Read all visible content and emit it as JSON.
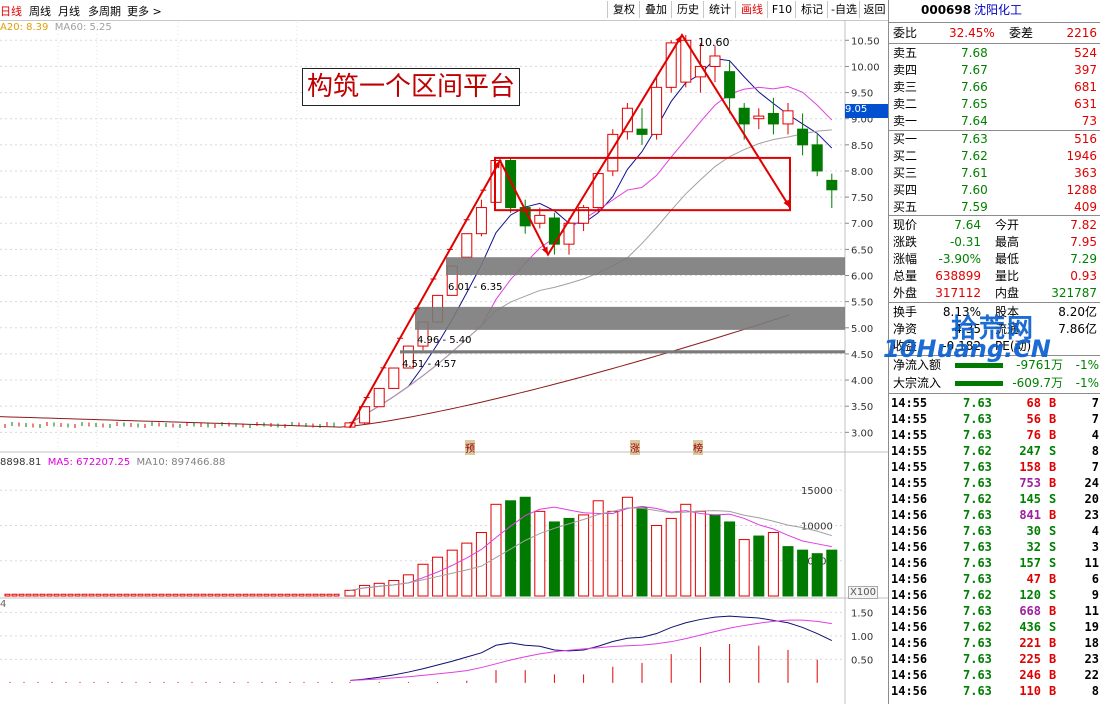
{
  "topbar": {
    "tabs": [
      "日线",
      "周线",
      "月线",
      "多周期",
      "更多 >"
    ],
    "buttons": [
      "复权",
      "叠加",
      "历史",
      "统计",
      "画线",
      "F10",
      "标记",
      "-自选",
      "返回"
    ],
    "active_button": "画线"
  },
  "indicators": {
    "ma_line": [
      "A20: 8.39",
      "MA60: 5.25"
    ],
    "vol_line": [
      "8898.81",
      "MA5: 672207.25",
      "MA10: 897466.88"
    ],
    "macd_line": "4",
    "vol_unit": "X100"
  },
  "annotations": {
    "headline": "构筑一个区间平台",
    "peak_label": "10.60",
    "gap1": "6.01 - 6.35",
    "gap2": "4.96 - 5.40",
    "gap3": "4.51 - 4.57",
    "markers": [
      "预",
      "涨",
      "榜"
    ],
    "price_tag": "9.05"
  },
  "colors": {
    "up": "#e00000",
    "down": "#007a00",
    "accent": "#e00000"
  },
  "chart_data": {
    "type": "candlestick",
    "price_axis": {
      "ticks": [
        "10.50",
        "10.00",
        "9.50",
        "9.00",
        "8.50",
        "8.00",
        "7.50",
        "7.00",
        "6.50",
        "6.00",
        "5.50",
        "5.00",
        "4.50",
        "4.00",
        "3.50",
        "3.00"
      ],
      "range": [
        2.7,
        10.85
      ]
    },
    "volume_axis": {
      "ticks": [
        "15000",
        "10000",
        "5000"
      ],
      "range": [
        0,
        19000
      ]
    },
    "macd_axis": {
      "ticks": [
        "1.50",
        "1.00",
        "0.50"
      ],
      "range": [
        -0.45,
        1.7
      ]
    },
    "candles": [
      {
        "o": 3.1,
        "h": 3.2,
        "l": 3.08,
        "c": 3.18
      },
      {
        "o": 3.18,
        "h": 3.5,
        "l": 3.15,
        "c": 3.49
      },
      {
        "o": 3.49,
        "h": 3.85,
        "l": 3.49,
        "c": 3.84
      },
      {
        "o": 3.84,
        "h": 4.24,
        "l": 3.84,
        "c": 4.23
      },
      {
        "o": 4.23,
        "h": 4.66,
        "l": 4.23,
        "c": 4.65
      },
      {
        "o": 4.65,
        "h": 5.12,
        "l": 4.57,
        "c": 5.11
      },
      {
        "o": 5.11,
        "h": 5.62,
        "l": 5.11,
        "c": 5.62
      },
      {
        "o": 5.62,
        "h": 6.18,
        "l": 5.62,
        "c": 6.18
      },
      {
        "o": 6.35,
        "h": 6.8,
        "l": 6.35,
        "c": 6.8
      },
      {
        "o": 6.8,
        "h": 7.45,
        "l": 6.75,
        "c": 7.3
      },
      {
        "o": 7.4,
        "h": 8.2,
        "l": 7.4,
        "c": 8.2
      },
      {
        "o": 8.2,
        "h": 8.25,
        "l": 7.2,
        "c": 7.3
      },
      {
        "o": 7.3,
        "h": 7.45,
        "l": 6.8,
        "c": 6.95
      },
      {
        "o": 7.0,
        "h": 7.3,
        "l": 6.9,
        "c": 7.15
      },
      {
        "o": 7.1,
        "h": 7.2,
        "l": 6.4,
        "c": 6.6
      },
      {
        "o": 6.6,
        "h": 7.1,
        "l": 6.4,
        "c": 7.0
      },
      {
        "o": 7.0,
        "h": 7.35,
        "l": 6.85,
        "c": 7.3
      },
      {
        "o": 7.3,
        "h": 8.0,
        "l": 7.2,
        "c": 7.95
      },
      {
        "o": 8.0,
        "h": 8.8,
        "l": 7.9,
        "c": 8.7
      },
      {
        "o": 8.75,
        "h": 9.3,
        "l": 8.6,
        "c": 9.2
      },
      {
        "o": 8.8,
        "h": 9.2,
        "l": 8.5,
        "c": 8.7
      },
      {
        "o": 8.7,
        "h": 9.8,
        "l": 8.6,
        "c": 9.6
      },
      {
        "o": 9.6,
        "h": 10.5,
        "l": 9.5,
        "c": 10.45
      },
      {
        "o": 9.7,
        "h": 10.6,
        "l": 9.6,
        "c": 10.5
      },
      {
        "o": 9.8,
        "h": 10.45,
        "l": 9.5,
        "c": 10.0
      },
      {
        "o": 10.0,
        "h": 10.4,
        "l": 9.7,
        "c": 10.2
      },
      {
        "o": 9.9,
        "h": 10.1,
        "l": 9.1,
        "c": 9.4
      },
      {
        "o": 9.2,
        "h": 9.3,
        "l": 8.6,
        "c": 8.9
      },
      {
        "o": 9.0,
        "h": 9.2,
        "l": 8.8,
        "c": 9.05
      },
      {
        "o": 9.1,
        "h": 9.4,
        "l": 8.7,
        "c": 8.9
      },
      {
        "o": 8.9,
        "h": 9.3,
        "l": 8.7,
        "c": 9.15
      },
      {
        "o": 8.8,
        "h": 9.1,
        "l": 8.3,
        "c": 8.5
      },
      {
        "o": 8.5,
        "h": 8.7,
        "l": 7.9,
        "c": 8.0
      },
      {
        "o": 7.82,
        "h": 7.95,
        "l": 7.29,
        "c": 7.64
      }
    ],
    "volume": [
      {
        "v": 800,
        "up": true
      },
      {
        "v": 1500,
        "up": true
      },
      {
        "v": 1800,
        "up": true
      },
      {
        "v": 2200,
        "up": true
      },
      {
        "v": 3000,
        "up": true
      },
      {
        "v": 4500,
        "up": true
      },
      {
        "v": 5500,
        "up": true
      },
      {
        "v": 6500,
        "up": true
      },
      {
        "v": 7500,
        "up": true
      },
      {
        "v": 9000,
        "up": true
      },
      {
        "v": 13000,
        "up": true
      },
      {
        "v": 13500,
        "up": false
      },
      {
        "v": 14000,
        "up": false
      },
      {
        "v": 12000,
        "up": true
      },
      {
        "v": 10500,
        "up": false
      },
      {
        "v": 11000,
        "up": false
      },
      {
        "v": 11500,
        "up": true
      },
      {
        "v": 13500,
        "up": true
      },
      {
        "v": 12000,
        "up": true
      },
      {
        "v": 14000,
        "up": true
      },
      {
        "v": 12500,
        "up": false
      },
      {
        "v": 10000,
        "up": true
      },
      {
        "v": 11000,
        "up": true
      },
      {
        "v": 13000,
        "up": true
      },
      {
        "v": 12000,
        "up": true
      },
      {
        "v": 11500,
        "up": false
      },
      {
        "v": 10500,
        "up": false
      },
      {
        "v": 8000,
        "up": true
      },
      {
        "v": 8500,
        "up": false
      },
      {
        "v": 9000,
        "up": true
      },
      {
        "v": 7000,
        "up": false
      },
      {
        "v": 6500,
        "up": false
      },
      {
        "v": 6000,
        "up": false
      },
      {
        "v": 6500,
        "up": false
      }
    ],
    "macd": [
      0.05,
      0.08,
      0.12,
      0.17,
      0.23,
      0.3,
      0.38,
      0.46,
      0.55,
      0.64,
      0.8,
      0.85,
      0.8,
      0.78,
      0.7,
      0.68,
      0.7,
      0.78,
      0.88,
      0.95,
      0.97,
      1.05,
      1.18,
      1.28,
      1.35,
      1.4,
      1.42,
      1.4,
      1.38,
      1.33,
      1.28,
      1.18,
      1.05,
      0.9
    ]
  },
  "quote": {
    "code": "000698",
    "name": "沈阳化工",
    "weibi": {
      "label": "委比",
      "value": "32.45%",
      "label2": "委差",
      "value2": "2216"
    },
    "sells": [
      {
        "label": "卖五",
        "price": "7.68",
        "vol": "524"
      },
      {
        "label": "卖四",
        "price": "7.67",
        "vol": "397"
      },
      {
        "label": "卖三",
        "price": "7.66",
        "vol": "681"
      },
      {
        "label": "卖二",
        "price": "7.65",
        "vol": "631"
      },
      {
        "label": "卖一",
        "price": "7.64",
        "vol": "73"
      }
    ],
    "buys": [
      {
        "label": "买一",
        "price": "7.63",
        "vol": "516"
      },
      {
        "label": "买二",
        "price": "7.62",
        "vol": "1946"
      },
      {
        "label": "买三",
        "price": "7.61",
        "vol": "363"
      },
      {
        "label": "买四",
        "price": "7.60",
        "vol": "1288"
      },
      {
        "label": "买五",
        "price": "7.59",
        "vol": "409"
      }
    ],
    "stats": [
      {
        "l1": "现价",
        "v1": "7.64",
        "c1": "green",
        "l2": "今开",
        "v2": "7.82",
        "c2": "red"
      },
      {
        "l1": "涨跌",
        "v1": "-0.31",
        "c1": "green",
        "l2": "最高",
        "v2": "7.95",
        "c2": "red"
      },
      {
        "l1": "涨幅",
        "v1": "-3.90%",
        "c1": "green",
        "l2": "最低",
        "v2": "7.29",
        "c2": "green"
      },
      {
        "l1": "总量",
        "v1": "638899",
        "c1": "red",
        "l2": "量比",
        "v2": "0.93",
        "c2": "red"
      },
      {
        "l1": "外盘",
        "v1": "317112",
        "c1": "red",
        "l2": "内盘",
        "v2": "321787",
        "c2": "green"
      }
    ],
    "stats2": [
      {
        "l1": "换手",
        "v1": "8.13%",
        "l2": "股本",
        "v2": "8.20亿"
      },
      {
        "l1": "净资",
        "v1": "4.35",
        "l2": "流通",
        "v2": "7.86亿"
      },
      {
        "l1": "收益",
        "v1": "-0.182",
        "l2": "PE(动)",
        "v2": ""
      }
    ],
    "flows": [
      {
        "label": "净流入额",
        "value": "-9761万",
        "pct": "-1%"
      },
      {
        "label": "大宗流入",
        "value": "-609.7万",
        "pct": "-1%"
      }
    ],
    "watermark": {
      "line1": "拾荒网",
      "line2": "10Huang.CN"
    },
    "ticks": [
      {
        "t": "14:55",
        "p": "7.63",
        "v": "68",
        "bs": "B",
        "n": "7"
      },
      {
        "t": "14:55",
        "p": "7.63",
        "v": "56",
        "bs": "B",
        "n": "7"
      },
      {
        "t": "14:55",
        "p": "7.63",
        "v": "76",
        "bs": "B",
        "n": "4"
      },
      {
        "t": "14:55",
        "p": "7.62",
        "v": "247",
        "bs": "S",
        "n": "8"
      },
      {
        "t": "14:55",
        "p": "7.63",
        "v": "158",
        "bs": "B",
        "n": "7"
      },
      {
        "t": "14:55",
        "p": "7.63",
        "v": "753",
        "bs": "B",
        "n": "24"
      },
      {
        "t": "14:56",
        "p": "7.62",
        "v": "145",
        "bs": "S",
        "n": "20"
      },
      {
        "t": "14:56",
        "p": "7.63",
        "v": "841",
        "bs": "B",
        "n": "23"
      },
      {
        "t": "14:56",
        "p": "7.63",
        "v": "30",
        "bs": "S",
        "n": "4"
      },
      {
        "t": "14:56",
        "p": "7.63",
        "v": "32",
        "bs": "S",
        "n": "3"
      },
      {
        "t": "14:56",
        "p": "7.63",
        "v": "157",
        "bs": "S",
        "n": "11"
      },
      {
        "t": "14:56",
        "p": "7.63",
        "v": "47",
        "bs": "B",
        "n": "6"
      },
      {
        "t": "14:56",
        "p": "7.62",
        "v": "120",
        "bs": "S",
        "n": "9"
      },
      {
        "t": "14:56",
        "p": "7.63",
        "v": "668",
        "bs": "B",
        "n": "11"
      },
      {
        "t": "14:56",
        "p": "7.62",
        "v": "436",
        "bs": "S",
        "n": "19"
      },
      {
        "t": "14:56",
        "p": "7.63",
        "v": "221",
        "bs": "B",
        "n": "18"
      },
      {
        "t": "14:56",
        "p": "7.63",
        "v": "225",
        "bs": "B",
        "n": "23"
      },
      {
        "t": "14:56",
        "p": "7.63",
        "v": "246",
        "bs": "B",
        "n": "22"
      },
      {
        "t": "14:56",
        "p": "7.63",
        "v": "110",
        "bs": "B",
        "n": "8"
      }
    ]
  }
}
